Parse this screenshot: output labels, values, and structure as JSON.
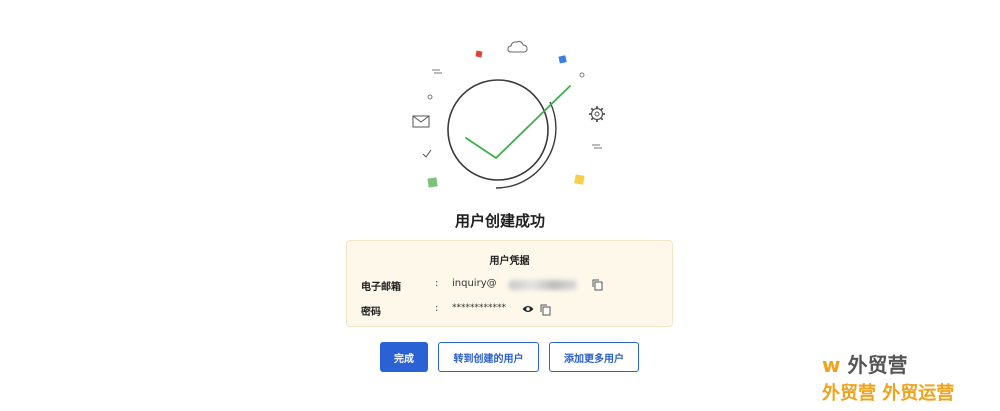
{
  "page": {
    "title": "用户创建成功"
  },
  "credentials": {
    "heading": "用户凭据",
    "email": {
      "label": "电子邮箱",
      "separator": ":",
      "value": "inquiry@"
    },
    "password": {
      "label": "密码",
      "separator": ":",
      "value": "************"
    }
  },
  "actions": {
    "done_label": "完成",
    "goto_user_label": "转到创建的用户",
    "add_more_label": "添加更多用户"
  },
  "watermark": {
    "line1_prefix": "w",
    "line1_brand": "外贸营",
    "line2": "外贸营 外贸运营"
  },
  "colors": {
    "primary": "#2a62d6",
    "check": "#3fae49",
    "card_bg": "#fdf8ea",
    "watermark": "#f2a11b"
  },
  "icons": [
    "cloud-icon",
    "envelope-icon",
    "gear-icon",
    "check-small-icon",
    "copy-icon",
    "eye-icon",
    "success-check-icon"
  ]
}
